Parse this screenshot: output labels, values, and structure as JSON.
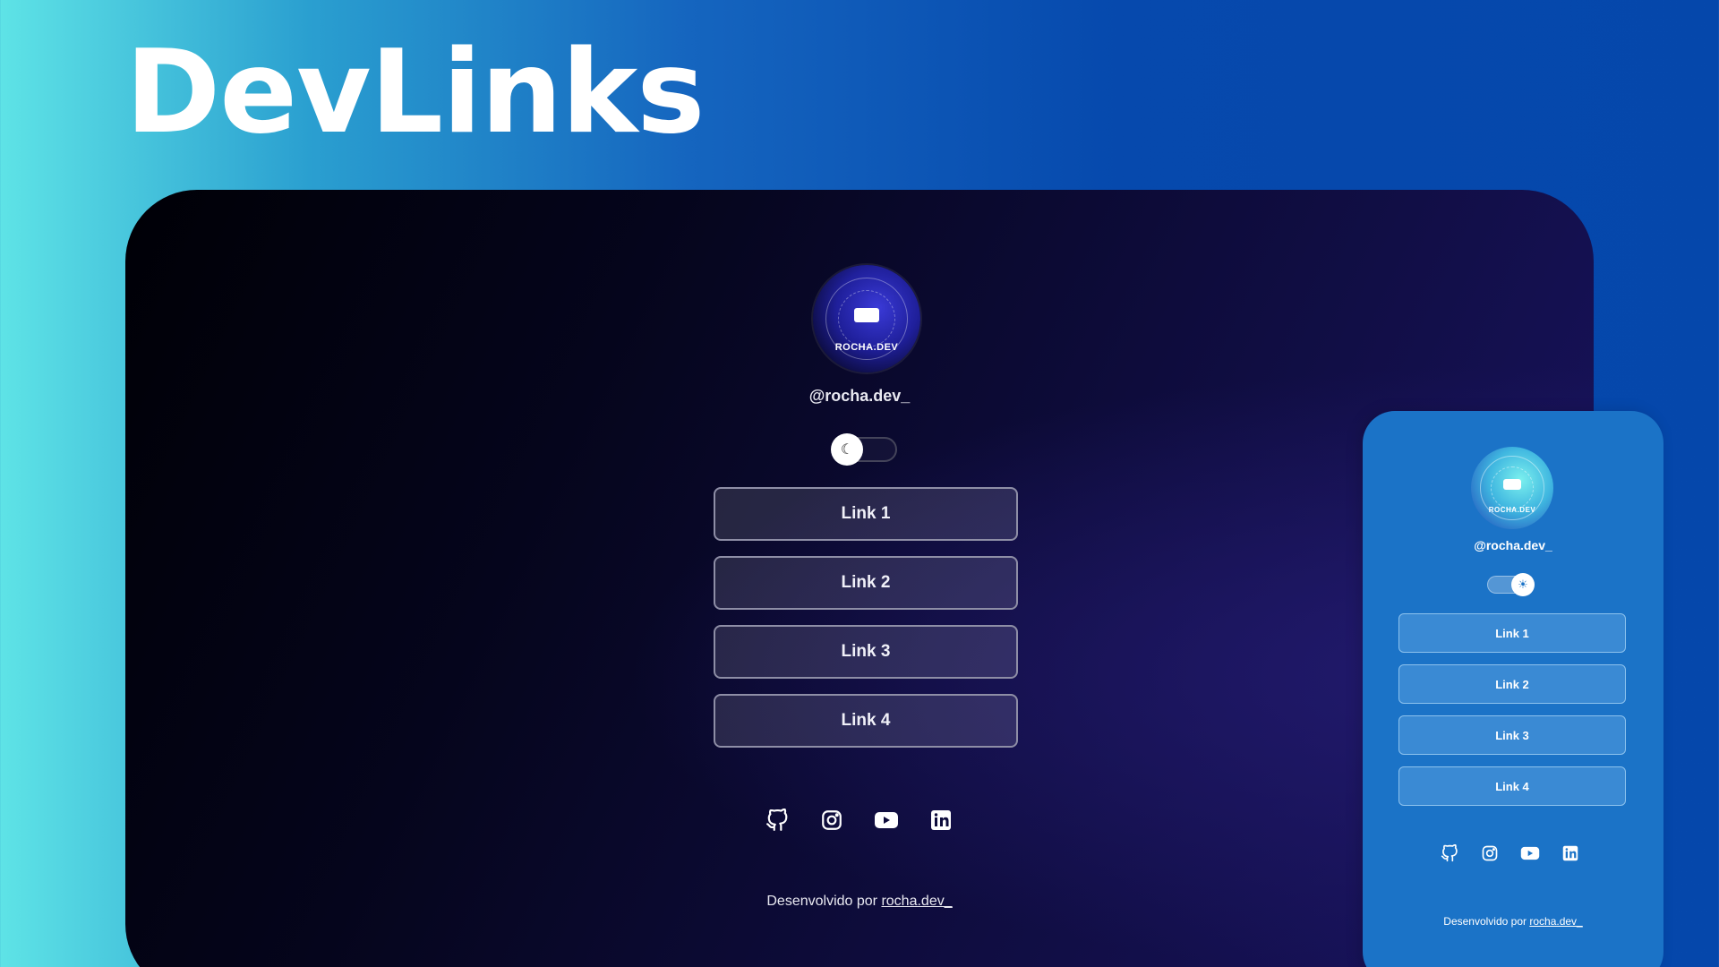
{
  "hero": {
    "title": "DevLinks"
  },
  "desktop": {
    "avatar_text": "ROCHA.DEV",
    "username": "@rocha.dev_",
    "links": [
      {
        "label": "Link 1"
      },
      {
        "label": "Link 2"
      },
      {
        "label": "Link 3"
      },
      {
        "label": "Link 4"
      }
    ],
    "socials": [
      "github-icon",
      "instagram-icon",
      "youtube-icon",
      "linkedin-icon"
    ],
    "footer": {
      "prefix": "Desenvolvido por ",
      "link": "rocha.dev_"
    },
    "theme": "dark"
  },
  "mobile": {
    "avatar_text": "ROCHA.DEV",
    "username": "@rocha.dev_",
    "links": [
      {
        "label": "Link 1"
      },
      {
        "label": "Link 2"
      },
      {
        "label": "Link 3"
      },
      {
        "label": "Link 4"
      }
    ],
    "socials": [
      "github-icon",
      "instagram-icon",
      "youtube-icon",
      "linkedin-icon"
    ],
    "footer": {
      "prefix": "Desenvolvido por ",
      "link": "rocha.dev_"
    },
    "theme": "light"
  },
  "colors": {
    "desktop_bg": "#0e0c3c",
    "mobile_bg": "#1b73c7",
    "page_gradient_start": "#5ee3e6",
    "page_gradient_end": "#0547ab"
  }
}
